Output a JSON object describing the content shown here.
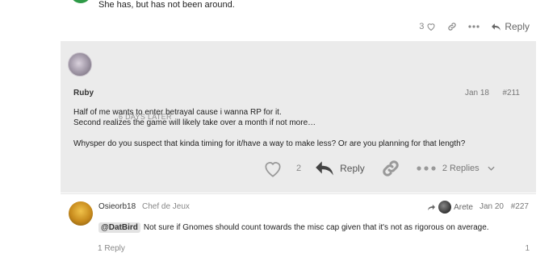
{
  "post1": {
    "text": "She has, but has not been around.",
    "like_count": "3",
    "reply_label": "Reply"
  },
  "time_gap": "6 DAYS LATER",
  "post2": {
    "username": "Ruby",
    "date": "Jan 18",
    "post_number": "#211",
    "body_line1": "Half of me wants to enter betrayal cause i wanna RP for it.",
    "body_line2": "Second realizes the game will likely take over a month if not more…",
    "body_line3": "Whysper do you suspect that kinda timing for it/have a way to make less? Or are you planning for that length?",
    "like_count": "2",
    "reply_label": "Reply",
    "replies_label": "2 Replies"
  },
  "post3": {
    "username": "Osieorb18",
    "user_title": "Chef de Jeux",
    "reply_to_user": "Arete",
    "date": "Jan 20",
    "post_number": "#227",
    "mention": "@DatBird",
    "body_text": "Not sure if Gnomes should count towards the misc cap given that it's not as rigorous on average.",
    "bottom_replies": "1 Reply",
    "bottom_likes": "1"
  },
  "colors": {
    "highlight_bg": "#ebebeb",
    "post1_avatar": "#2e9a47"
  }
}
